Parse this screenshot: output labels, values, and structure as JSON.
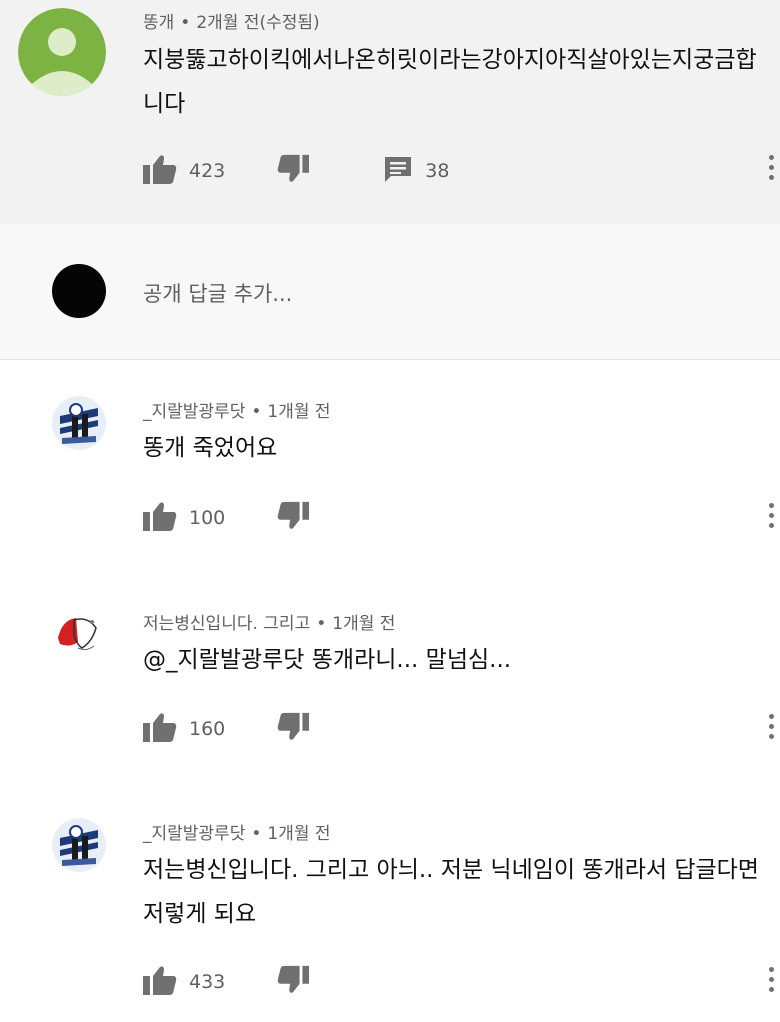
{
  "comments": [
    {
      "author": "똥개",
      "time": "2개월 전(수정됨)",
      "text": "지붕뚫고하이킥에서나온히릿이라는강아지아직살아있는지궁금합니다",
      "likes": "423",
      "replies": "38"
    },
    {
      "author": "_지랄발광루닷",
      "time": "1개월 전",
      "text": "똥개 죽었어요",
      "likes": "100"
    },
    {
      "author": "저는병신입니다. 그리고",
      "time": "1개월 전",
      "text": "@_지랄발광루닷 똥개라니... 말넘심...",
      "likes": "160"
    },
    {
      "author": "_지랄발광루닷",
      "time": "1개월 전",
      "text": "저는병신입니다. 그리고 아늬.. 저분 닉네임이 똥개라서 답글다면 저렇게 되요",
      "likes": "433"
    }
  ],
  "reply_box": {
    "placeholder": "공개 답글 추가..."
  },
  "meta_separator": "•",
  "icons": {
    "like": "thumb-up-icon",
    "dislike": "thumb-down-icon",
    "reply": "comment-icon",
    "more": "more-vertical-icon"
  }
}
